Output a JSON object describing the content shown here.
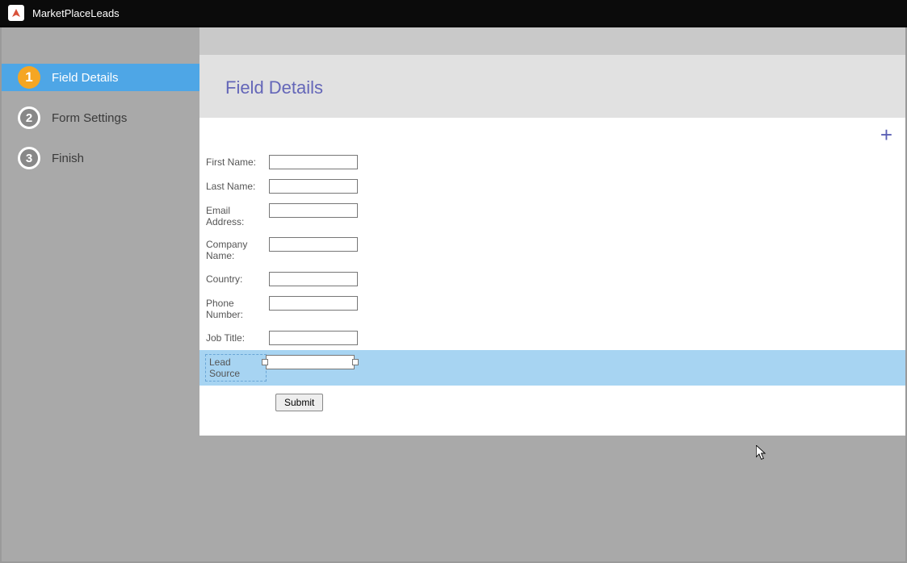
{
  "app": {
    "title": "MarketPlaceLeads"
  },
  "sidebar": {
    "steps": [
      {
        "num": "1",
        "label": "Field Details",
        "active": true
      },
      {
        "num": "2",
        "label": "Form Settings",
        "active": false
      },
      {
        "num": "3",
        "label": "Finish",
        "active": false
      }
    ]
  },
  "page": {
    "title": "Field Details"
  },
  "form": {
    "fields": [
      {
        "label": "First Name:",
        "value": ""
      },
      {
        "label": "Last Name:",
        "value": ""
      },
      {
        "label": "Email Address:",
        "value": ""
      },
      {
        "label": "Company Name:",
        "value": ""
      },
      {
        "label": "Country:",
        "value": ""
      },
      {
        "label": "Phone Number:",
        "value": ""
      },
      {
        "label": "Job Title:",
        "value": ""
      },
      {
        "label": "Lead Source",
        "value": "",
        "selected": true
      }
    ],
    "submit_label": "Submit"
  }
}
